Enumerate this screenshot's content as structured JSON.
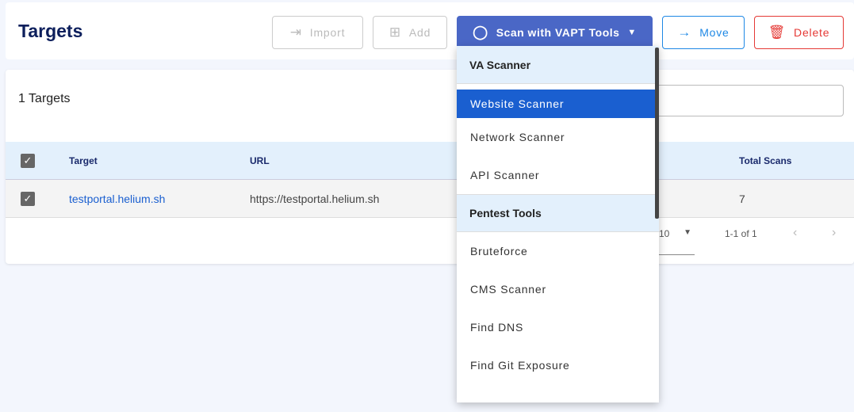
{
  "header": {
    "title": "Targets",
    "import": "Import",
    "add": "Add",
    "scan": "Scan with VAPT Tools",
    "move": "Move",
    "delete": "Delete"
  },
  "main": {
    "count": "1 Targets",
    "columns": [
      "Target",
      "URL",
      "Total Scans"
    ],
    "rows": [
      {
        "target": "testportal.helium.sh",
        "url": "https://testportal.helium.sh",
        "total_scans": "7",
        "checked": true
      }
    ],
    "pagination": {
      "rows_per_page": "10",
      "range": "1-1 of 1"
    }
  },
  "menu": {
    "sections": [
      {
        "header": "VA Scanner",
        "items": [
          "Website Scanner",
          "Network Scanner",
          "API Scanner"
        ]
      },
      {
        "header": "Pentest Tools",
        "items": [
          "Bruteforce",
          "CMS Scanner",
          "Find DNS",
          "Find Git Exposure"
        ]
      }
    ],
    "selected": "Website Scanner"
  },
  "colors": {
    "primary": "#4a67c6",
    "selected": "#1a5fd0",
    "move": "#1e88e5",
    "delete": "#e53935",
    "title": "#0d1f5c"
  }
}
